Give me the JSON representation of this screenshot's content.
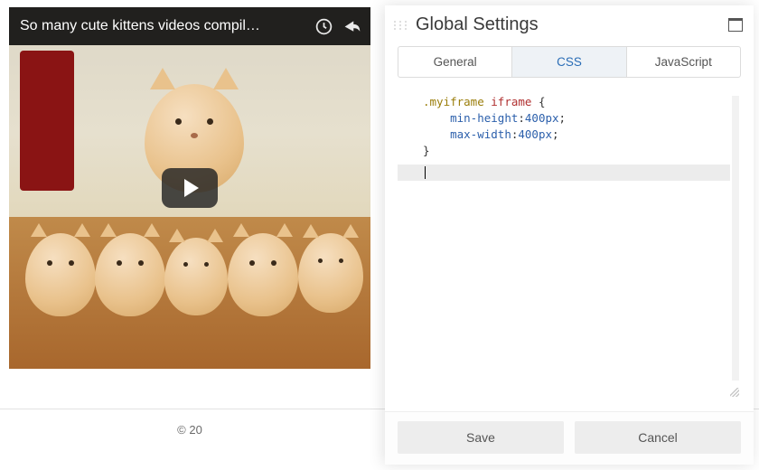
{
  "video": {
    "title": "So many cute kittens videos compil…",
    "watch_later_icon": "watch-later",
    "share_icon": "share",
    "play_icon": "play"
  },
  "footer": {
    "copyright": "© 20"
  },
  "panel": {
    "title": "Global Settings",
    "maximize_icon": "maximize",
    "tabs": {
      "general": "General",
      "css": "CSS",
      "javascript": "JavaScript",
      "active": "css"
    },
    "editor": {
      "line1_selector": ".myiframe",
      "line1_tag": "iframe",
      "line1_brace": " {",
      "line2_prop": "min-height",
      "line2_val": "400px",
      "line3_prop": "max-width",
      "line3_val": "400px",
      "line4": "}",
      "active_line_index": 5
    },
    "actions": {
      "save": "Save",
      "cancel": "Cancel"
    }
  }
}
